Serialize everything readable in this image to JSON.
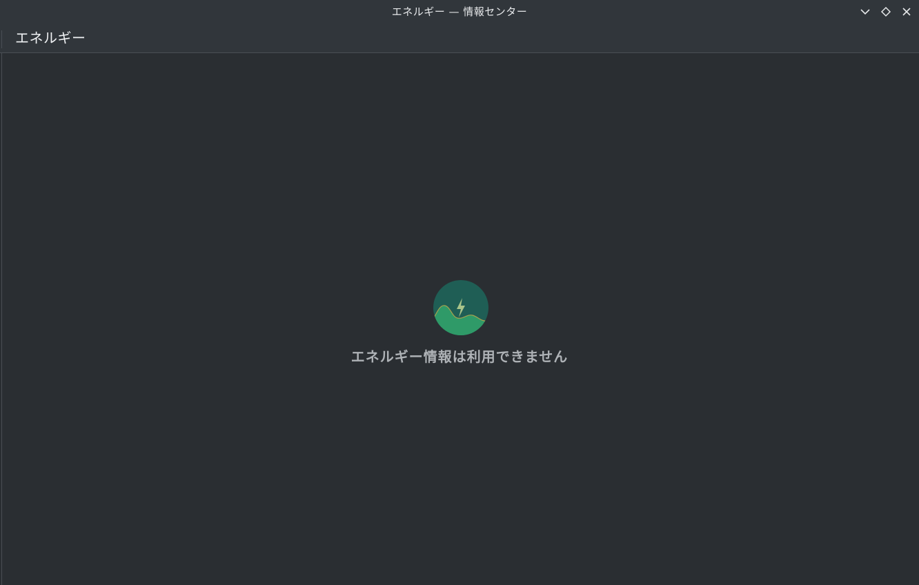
{
  "window": {
    "title": "エネルギー — 情報センター",
    "controls": {
      "minimize_icon": "chevron-down-icon",
      "maximize_icon": "diamond-icon",
      "close_icon": "close-icon"
    }
  },
  "header": {
    "title": "エネルギー"
  },
  "main": {
    "placeholder_icon": "energy-icon",
    "placeholder_message": "エネルギー情報は利用できません"
  },
  "colors": {
    "titlebar_bg": "#31363b",
    "content_bg": "#2a2e32",
    "icon_circle": "#1f5e55",
    "icon_hill": "#2f9a68",
    "icon_bolt": "#a9c48a",
    "message_text": "#aeb2b6"
  }
}
